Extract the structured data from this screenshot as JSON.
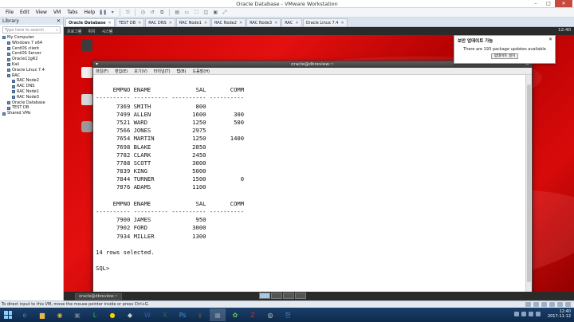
{
  "window": {
    "title": "Oracle Database - VMware Workstation"
  },
  "menubar": {
    "items": [
      "File",
      "Edit",
      "View",
      "VM",
      "Tabs",
      "Help"
    ]
  },
  "library": {
    "title": "Library",
    "search_placeholder": "Type here to search",
    "tree": [
      {
        "label": "My Computer",
        "level": 0
      },
      {
        "label": "Windows 7 x64",
        "level": 1
      },
      {
        "label": "CentOS client",
        "level": 1
      },
      {
        "label": "CentOS Server",
        "level": 1
      },
      {
        "label": "Oracle11gR2",
        "level": 1
      },
      {
        "label": "Kali",
        "level": 1
      },
      {
        "label": "Oracle Linux 7.4",
        "level": 1
      },
      {
        "label": "RAC",
        "level": 1
      },
      {
        "label": "RAC Node2",
        "level": 2
      },
      {
        "label": "RAC DNS",
        "level": 2
      },
      {
        "label": "RAC Node1",
        "level": 2
      },
      {
        "label": "RAC Node3",
        "level": 2
      },
      {
        "label": "Oracle Database",
        "level": 1
      },
      {
        "label": "TEST DB",
        "level": 1
      },
      {
        "label": "Shared VMs",
        "level": 0
      }
    ]
  },
  "tabs": [
    {
      "label": "Oracle Database",
      "active": true
    },
    {
      "label": "TEST DB",
      "active": false
    },
    {
      "label": "RAC DNS",
      "active": false
    },
    {
      "label": "RAC Node1",
      "active": false
    },
    {
      "label": "RAC Node2",
      "active": false
    },
    {
      "label": "RAC Node3",
      "active": false
    },
    {
      "label": "RAC",
      "active": false
    },
    {
      "label": "Oracle Linux 7.4",
      "active": false
    }
  ],
  "guest_topbar": {
    "apps": [
      "프로그램",
      "위치",
      "시스템"
    ],
    "clock": "12:40"
  },
  "popup": {
    "title": "보안 업데이트 가능",
    "message": "There are 193 package updates available",
    "button": "업데이트 설치"
  },
  "terminal": {
    "title": "oracle@dbreview:~",
    "menu": [
      "파일(F)",
      "편집(E)",
      "보기(V)",
      "터미널(T)",
      "탭(B)",
      "도움말(H)"
    ],
    "lines": [
      "",
      "     EMPNO ENAME             SAL       COMM",
      "---------- ---------- ---------- ----------",
      "      7369 SMITH             800",
      "      7499 ALLEN            1600        300",
      "      7521 WARD             1250        500",
      "      7566 JONES            2975",
      "      7654 MARTIN           1250       1400",
      "      7698 BLAKE            2850",
      "      7782 CLARK            2450",
      "      7788 SCOTT            3000",
      "      7839 KING             5000",
      "      7844 TURNER           1500          0",
      "      7876 ADAMS            1100",
      "",
      "     EMPNO ENAME             SAL       COMM",
      "---------- ---------- ---------- ----------",
      "      7900 JAMES             950",
      "      7902 FORD             3000",
      "      7934 MILLER           1300",
      "",
      "14 rows selected.",
      "",
      "SQL>"
    ]
  },
  "guest_taskbar": {
    "task": "oracle@dbreview:~"
  },
  "statusbar": {
    "text": "To direct input to this VM, move the mouse pointer inside or press Ctrl+G."
  },
  "taskbar": {
    "apps": [
      "ie-icon",
      "folder-icon",
      "chrome-icon",
      "vmware-icon",
      "line-icon",
      "kakaotalk-icon",
      "unity-icon",
      "word-icon",
      "excel-icon",
      "photoshop-icon",
      "terminal-icon",
      "vmware-workstation-icon",
      "photo-icon",
      "filezilla-icon",
      "media-icon",
      "hangul-icon"
    ],
    "time": "12:40",
    "date": "2017-11-12"
  }
}
